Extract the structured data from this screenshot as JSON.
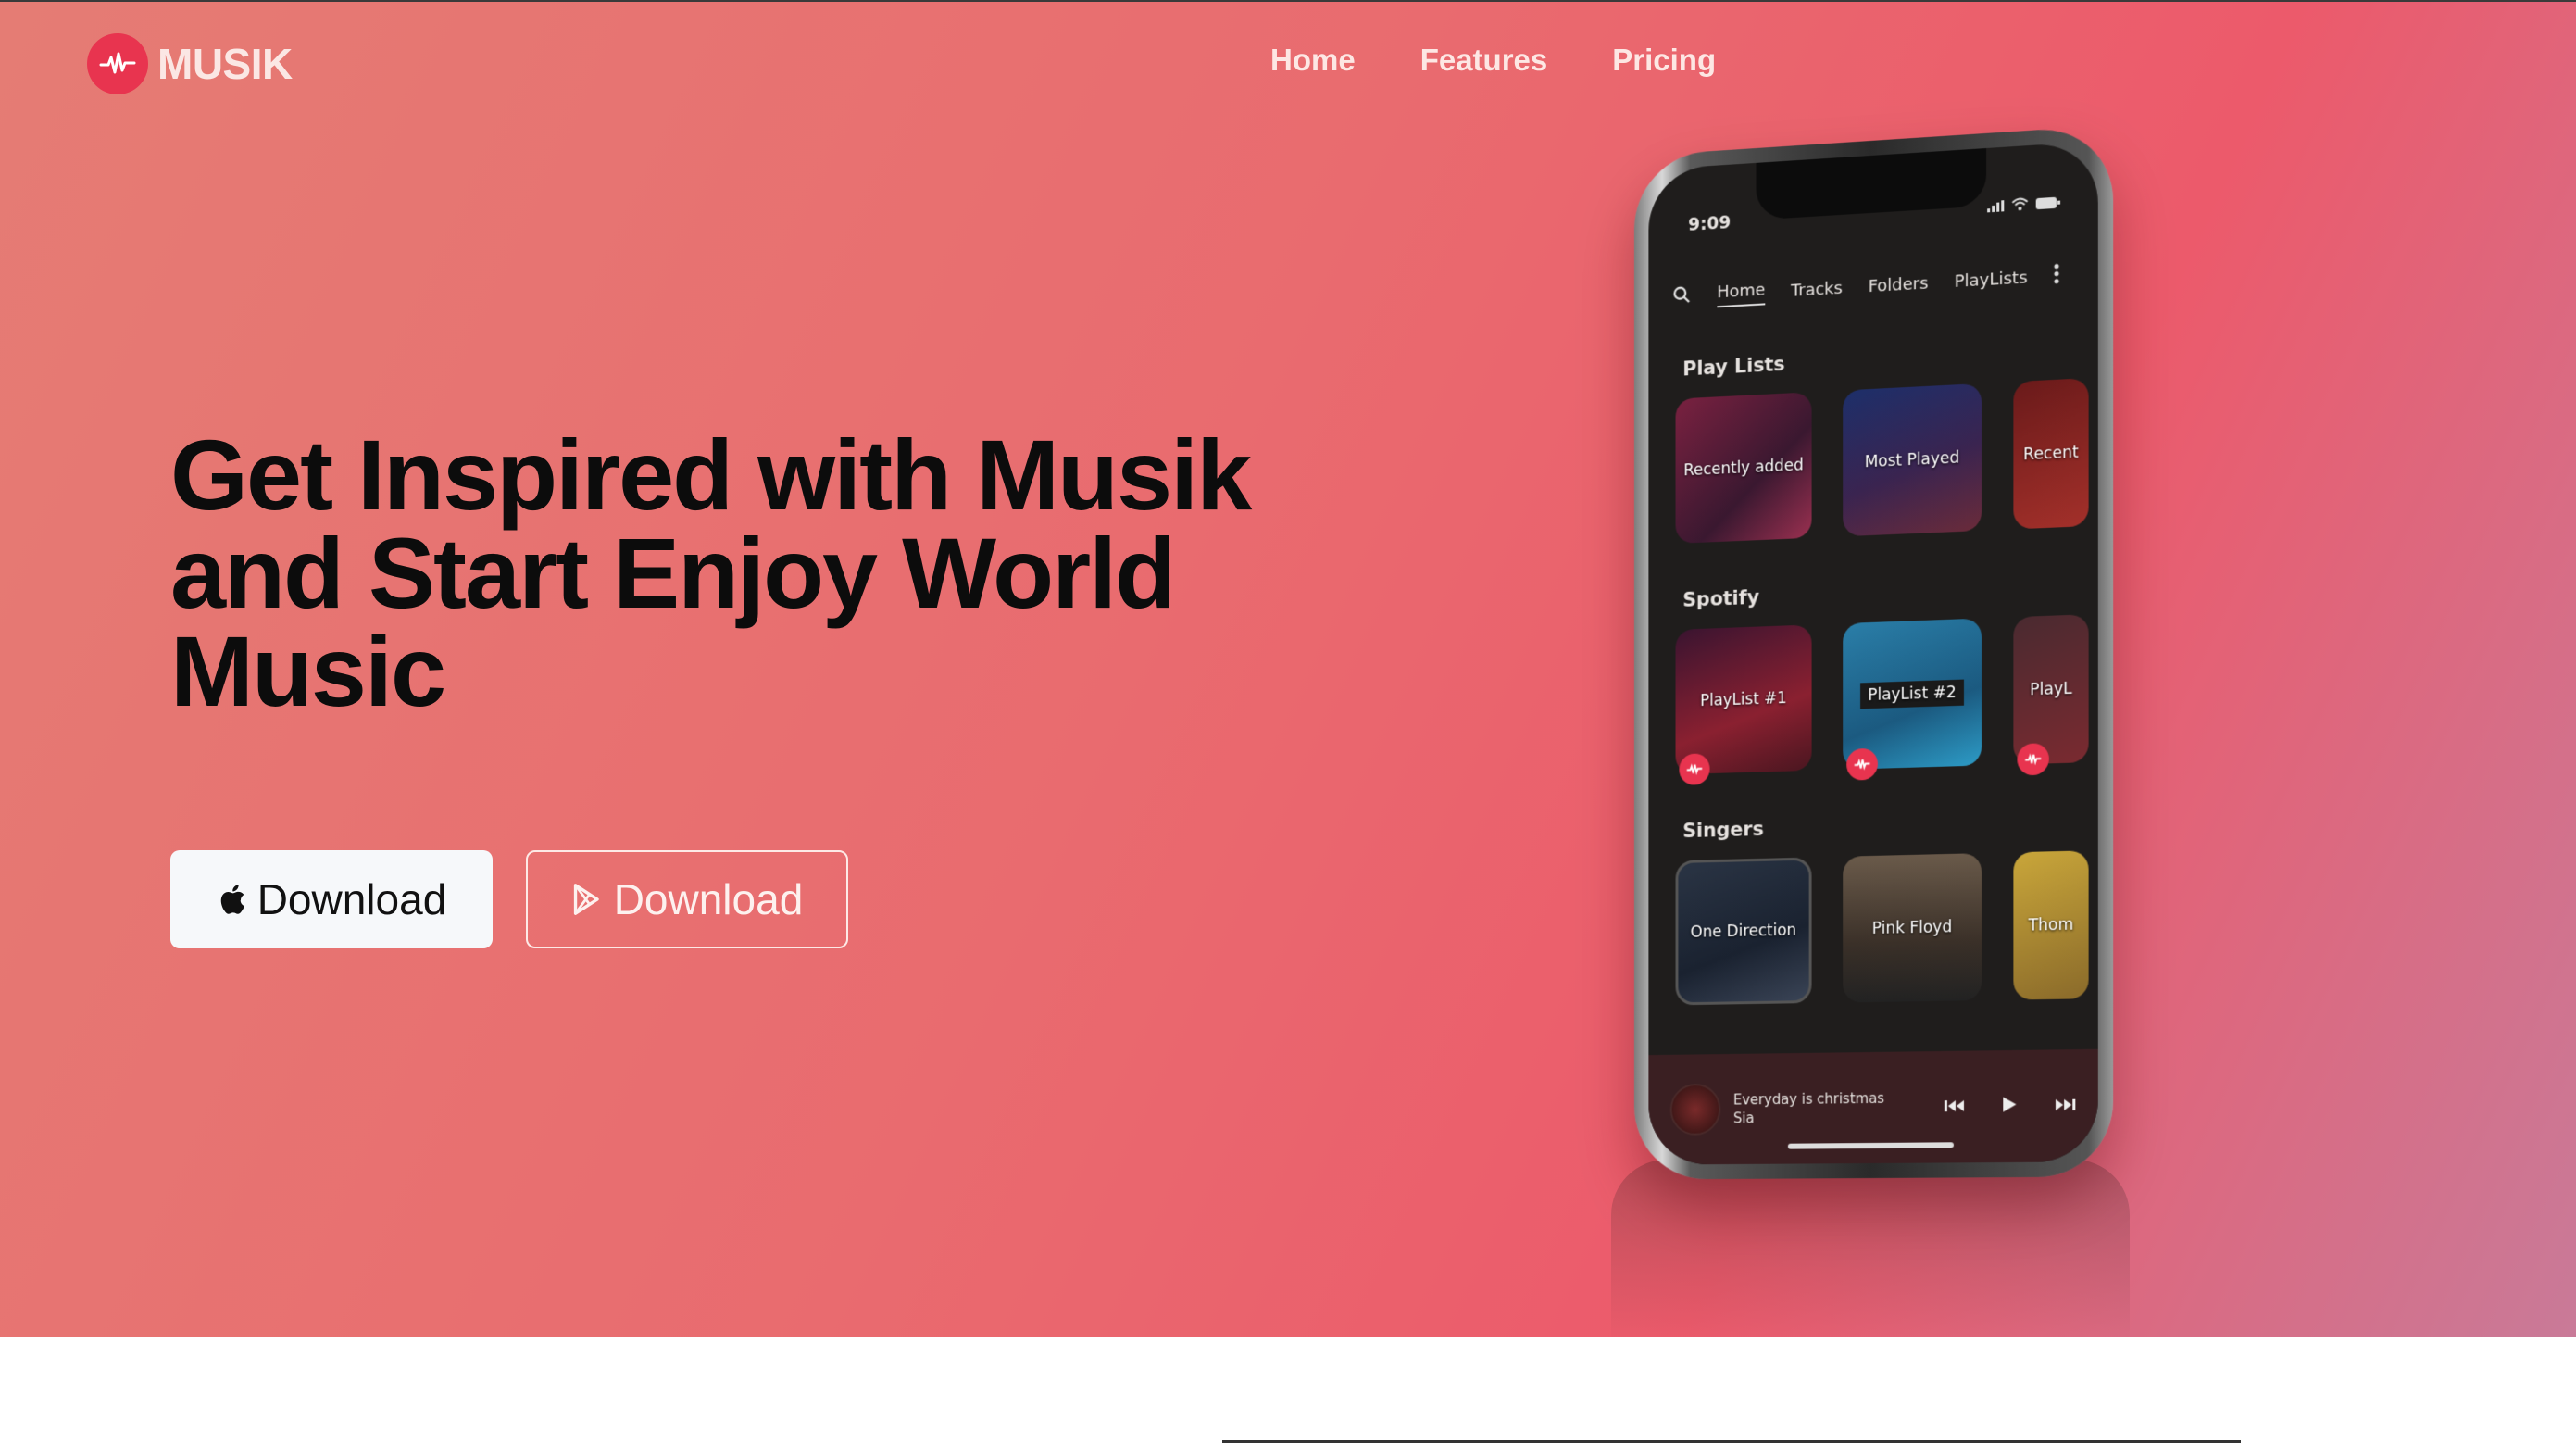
{
  "brand": {
    "name": "MUSIK",
    "logo_icon": "waveform-icon",
    "accent": "#e8344f"
  },
  "nav": {
    "items": [
      {
        "label": "Home"
      },
      {
        "label": "Features"
      },
      {
        "label": "Pricing"
      }
    ]
  },
  "hero": {
    "headline_line1": "Get Inspired with Musik",
    "headline_line2": "and Start Enjoy World",
    "headline_line3": "Music",
    "buttons": [
      {
        "label": "Download",
        "icon": "apple-icon"
      },
      {
        "label": "Download",
        "icon": "google-play-icon"
      }
    ]
  },
  "phone": {
    "time": "9:09",
    "tabs": [
      "Home",
      "Tracks",
      "Folders",
      "PlayLists"
    ],
    "sections": [
      {
        "title": "Play Lists",
        "cards": [
          "Recently added",
          "Most Played",
          "Recent"
        ]
      },
      {
        "title": "Spotify",
        "cards": [
          "PlayList #1",
          "PlayList #2",
          "PlayL"
        ]
      },
      {
        "title": "Singers",
        "cards": [
          "One Direction",
          "Pink Floyd",
          "Thom"
        ]
      }
    ],
    "player": {
      "song": "Everyday is christmas",
      "artist": "Sia"
    }
  }
}
